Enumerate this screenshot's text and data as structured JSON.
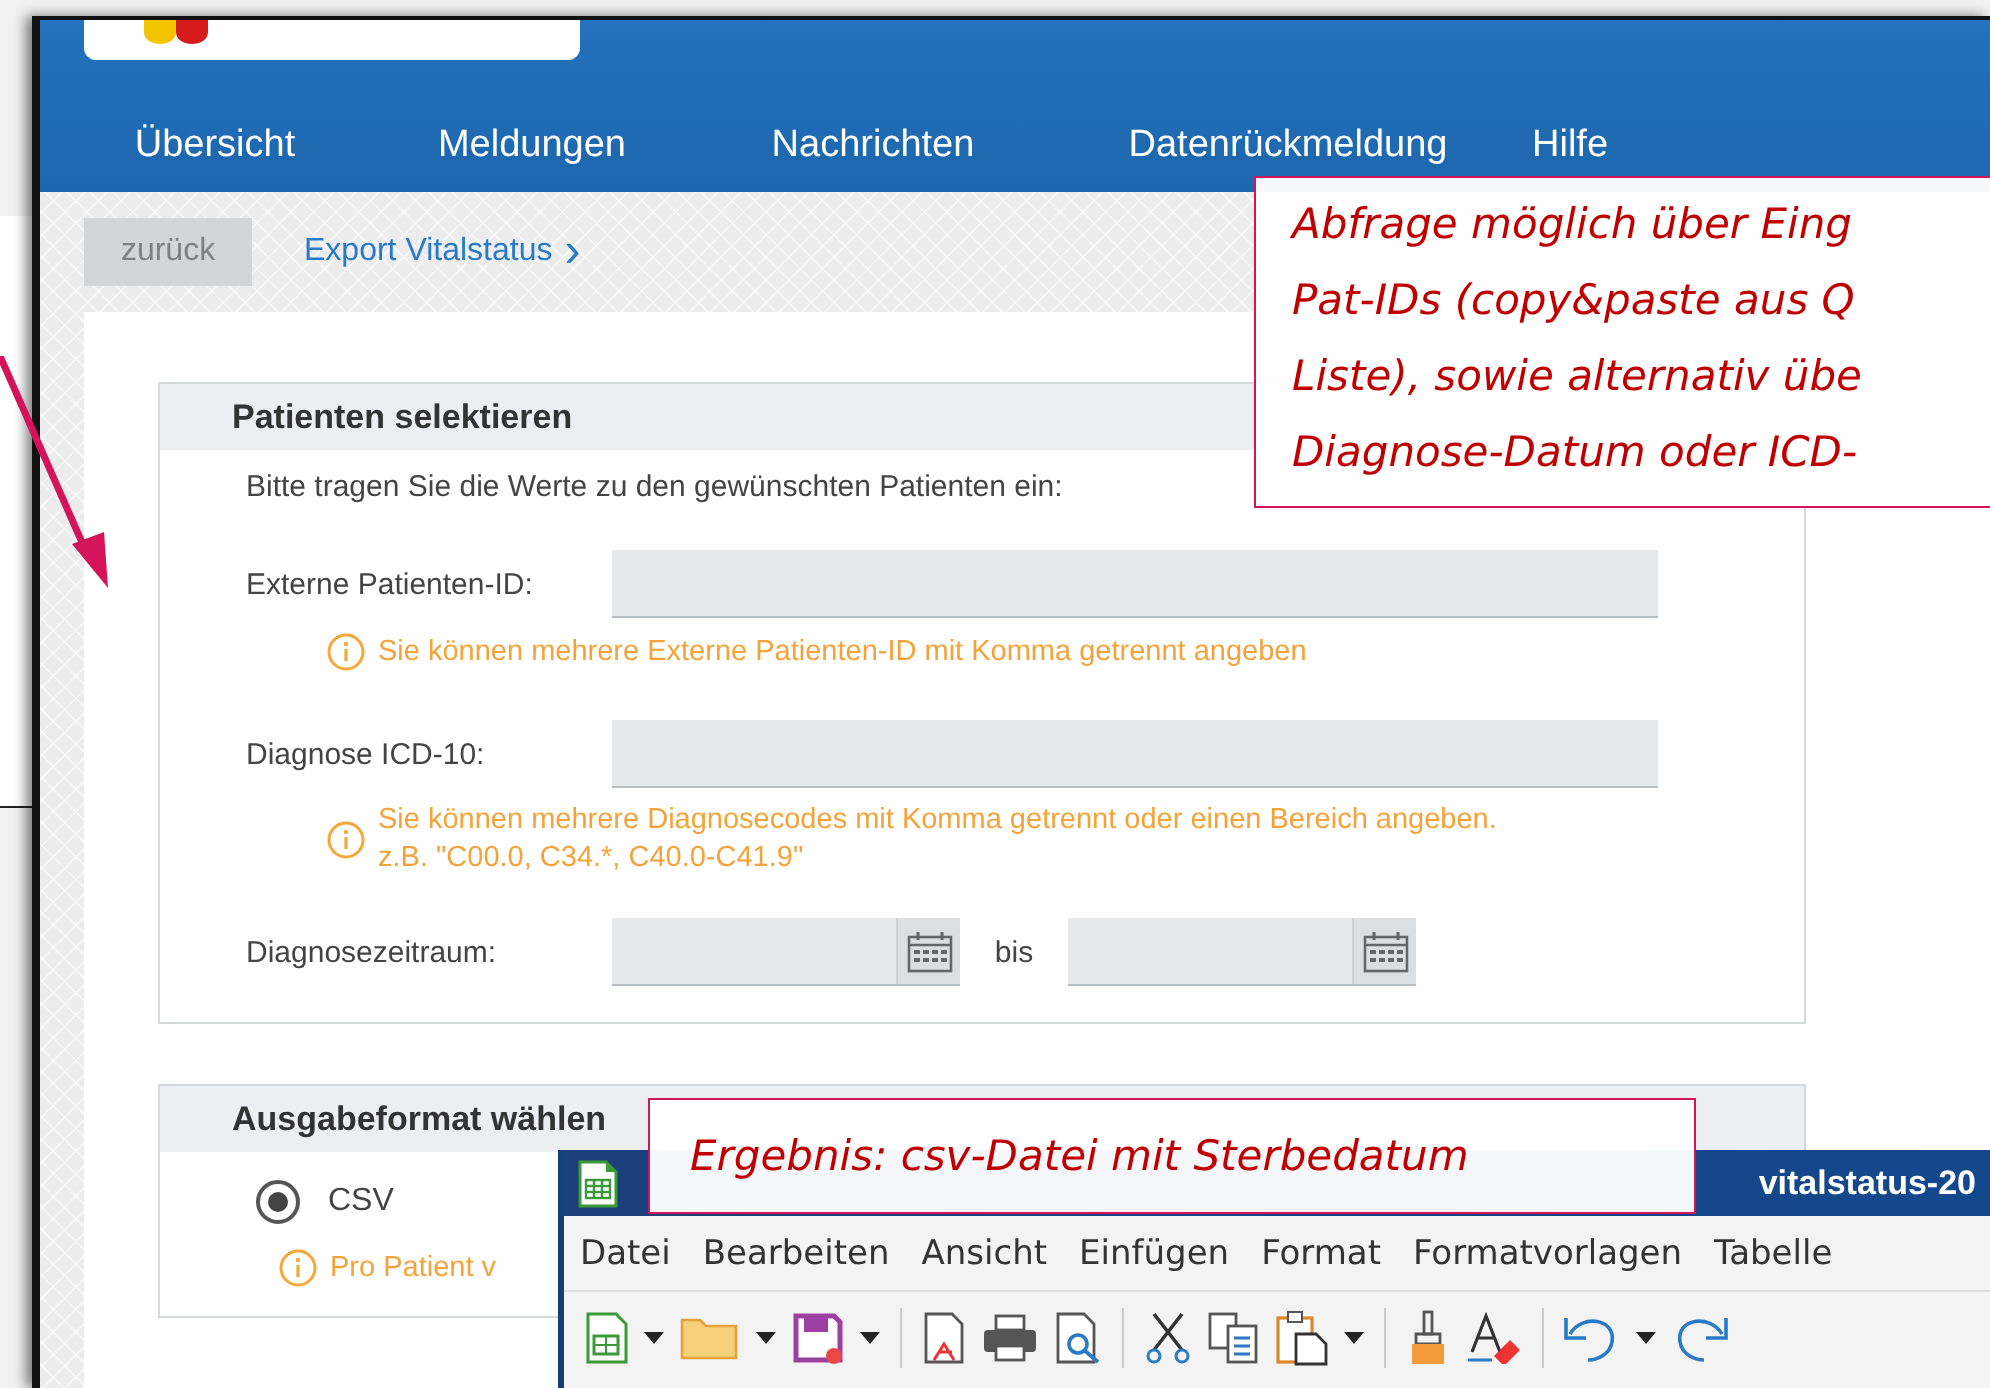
{
  "nav": [
    {
      "label": "Übersicht"
    },
    {
      "label": "Meldungen"
    },
    {
      "label": "Nachrichten"
    },
    {
      "label": "Datenrückmeldung"
    },
    {
      "label": "Hilfe"
    }
  ],
  "back_button": {
    "label": "zurück",
    "disabled": true
  },
  "breadcrumb": {
    "label": "Export Vitalstatus",
    "chevron": "›"
  },
  "patient_section": {
    "title": "Patienten selektieren",
    "intro": "Bitte tragen Sie die Werte zu den gewünschten Patienten ein:",
    "external_id": {
      "label": "Externe Patienten-ID:",
      "hint": [
        "Sie können mehrere Externe Patienten-ID mit Komma getrennt angeben"
      ]
    },
    "icd": {
      "label": "Diagnose ICD-10:",
      "hint": [
        "Sie können mehrere Diagnosecodes mit Komma getrennt oder einen Bereich angeben.",
        "z.B. \"C00.0, C34.*, C40.0-C41.9\""
      ]
    },
    "period": {
      "label": "Diagnosezeitraum:",
      "separator": "bis"
    }
  },
  "format_section": {
    "title": "Ausgabeformat wählen",
    "options": [
      {
        "label": "CSV",
        "selected": true
      }
    ],
    "hint": "Pro Patient v"
  },
  "callout_query": {
    "lines": [
      "Abfrage möglich über Eing",
      "Pat-IDs (copy&paste aus Q",
      "Liste), sowie alternativ übe",
      "Diagnose-Datum oder ICD-"
    ]
  },
  "callout_result": {
    "text": "Ergebnis: csv-Datei mit Sterbedatum"
  },
  "spreadsheet": {
    "title": "vitalstatus-20",
    "menu": [
      "Datei",
      "Bearbeiten",
      "Ansicht",
      "Einfügen",
      "Format",
      "Formatvorlagen",
      "Tabelle"
    ]
  }
}
